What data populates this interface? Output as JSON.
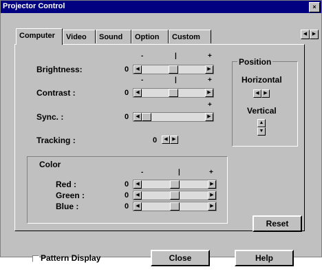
{
  "window": {
    "title": "Projector Control",
    "close_glyph": "×"
  },
  "tabs": [
    {
      "label": "Computer",
      "active": true
    },
    {
      "label": "Video",
      "active": false
    },
    {
      "label": "Sound",
      "active": false
    },
    {
      "label": "Option",
      "active": false
    },
    {
      "label": "Custom",
      "active": false
    }
  ],
  "tab_scroll": {
    "left_glyph": "◀",
    "right_glyph": "▶"
  },
  "scale": {
    "minus": "-",
    "center": "|",
    "plus": "+"
  },
  "settings": {
    "brightness": {
      "label": "Brightness:",
      "value": "0",
      "level": 0.5
    },
    "contrast": {
      "label": "Contrast   :",
      "value": "0",
      "level": 0.5
    },
    "sync": {
      "label": "Sync.      :",
      "value": "0",
      "level": 0.0
    },
    "tracking": {
      "label": "Tracking   :",
      "value": "0"
    }
  },
  "color": {
    "title": "Color",
    "red": {
      "label": "Red   :",
      "value": "0",
      "level": 0.5
    },
    "green": {
      "label": "Green :",
      "value": "0",
      "level": 0.5
    },
    "blue": {
      "label": "Blue  :",
      "value": "0",
      "level": 0.5
    }
  },
  "position": {
    "title": "Position",
    "horizontal": "Horizontal",
    "vertical": "Vertical"
  },
  "arrows": {
    "left": "◀",
    "right": "▶",
    "up": "▲",
    "down": "▼"
  },
  "buttons": {
    "reset": "Reset",
    "close": "Close",
    "help": "Help"
  },
  "pattern_display": {
    "label": "Pattern Display",
    "checked": false
  }
}
